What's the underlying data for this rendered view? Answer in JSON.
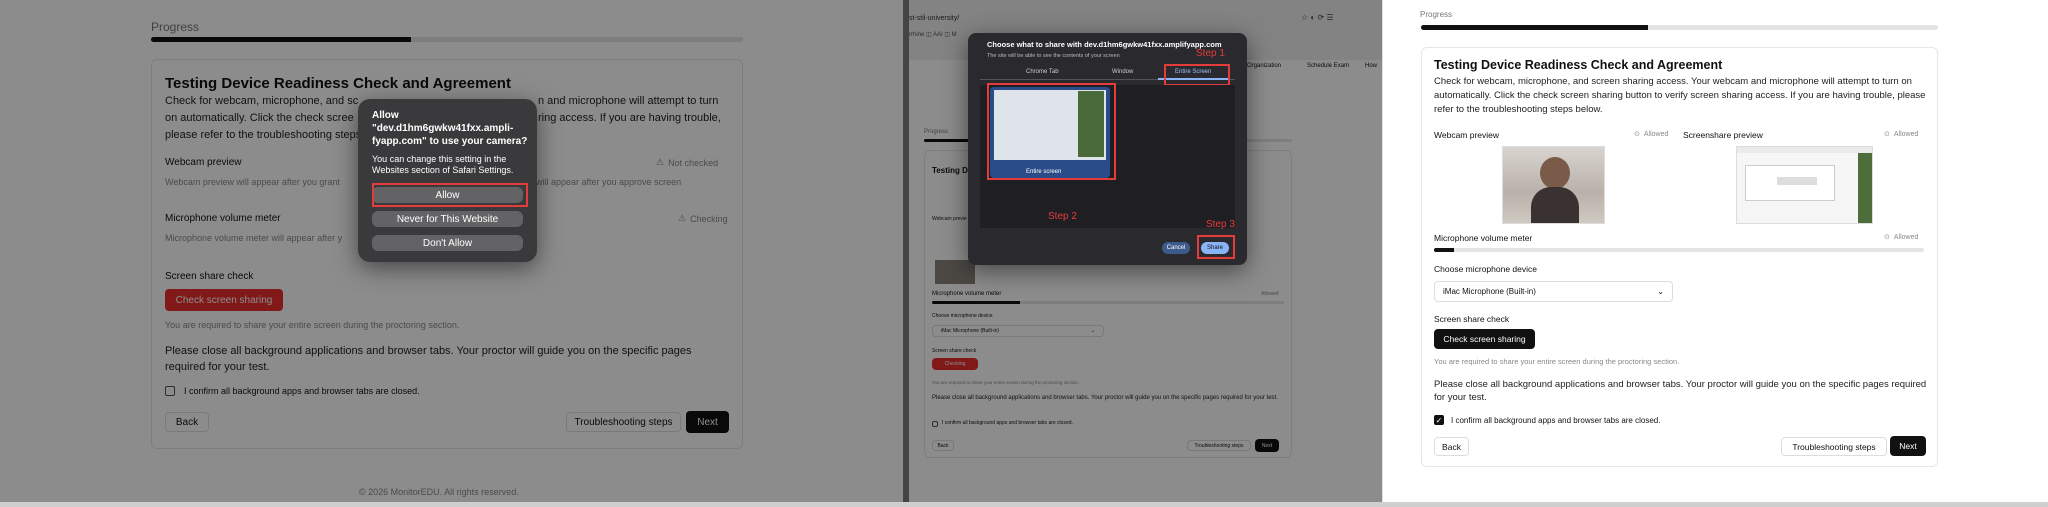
{
  "progress_label": "Progress",
  "progress_value": 0.44,
  "card_title": "Testing Device Readiness Check and Agreement",
  "card_intro": "Check for webcam, microphone, and screen sharing access. Your webcam and microphone will attempt to turn on automatically. Click the check screen sharing button to verify screen sharing access. If you are having trouble, please refer to the troubleshooting steps below.",
  "p1_intro_visible_start": "Check for webcam, microphone, and sc",
  "p1_intro_visible_end": "n and microphone will attempt to turn",
  "p1_intro_line2_start": "on automatically. Click the check scree",
  "p1_intro_line2_end": "ring access. If you are having trouble,",
  "p1_intro_line3": "please refer to the troubleshooting steps",
  "webcam_label": "Webcam preview",
  "webcam_placeholder": "Webcam preview will appear after you grant",
  "screenshare_status_not": "Not checked",
  "screenshare_placeholder": "will appear after you approve screen",
  "mic_label": "Microphone volume meter",
  "mic_placeholder": "Microphone volume meter will appear after y",
  "mic_status_checking": "Checking",
  "screen_check_label": "Screen share check",
  "check_btn": "Check screen sharing",
  "required_note": "You are required to share your entire screen during the proctoring section.",
  "close_note": "Please close all background applications and browser tabs. Your proctor will guide you on the specific pages required for your test.",
  "confirm_label": "I confirm all background apps and browser tabs are closed.",
  "back_btn": "Back",
  "troubleshoot_btn": "Troubleshooting steps",
  "next_btn": "Next",
  "footer": "© 2026 MonitorEDU. All rights reserved.",
  "safari_dialog": {
    "line1": "Allow",
    "line2": "\"dev.d1hm6gwkw41fxx.ampli-",
    "line3": "fyapp.com\" to use your camera?",
    "body": "You can change this setting in the Websites section of Safari Settings.",
    "allow": "Allow",
    "never": "Never for This Website",
    "dont": "Don't Allow"
  },
  "browser_url": "st-stil-university/",
  "share_dialog": {
    "title": "Choose what to share with dev.d1hm6gwkw41fxx.amplifyapp.com",
    "subtitle": "The site will be able to see the contents of your screen",
    "tabs": [
      "Chrome Tab",
      "Window",
      "Entire Screen"
    ],
    "thumb_caption": "Entire screen",
    "step1": "Step 1",
    "step2": "Step 2",
    "step3": "Step 3",
    "cancel": "Cancel",
    "share": "Share"
  },
  "bg_nav": [
    "Organization",
    "Schedule Exam",
    "How"
  ],
  "p3": {
    "webcam_label": "Webcam preview",
    "webcam_status": "Allowed",
    "screenshare_label": "Screenshare preview",
    "screenshare_status": "Allowed",
    "mic_label": "Microphone volume meter",
    "mic_status": "Allowed",
    "mic_level": 0.04,
    "choose_mic_label": "Choose microphone device",
    "mic_device": "iMac Microphone (Built-in)"
  },
  "colors": {
    "accent_red": "#e43b3b",
    "button_black": "#111111",
    "check_btn_red": "#ec2f2f"
  }
}
